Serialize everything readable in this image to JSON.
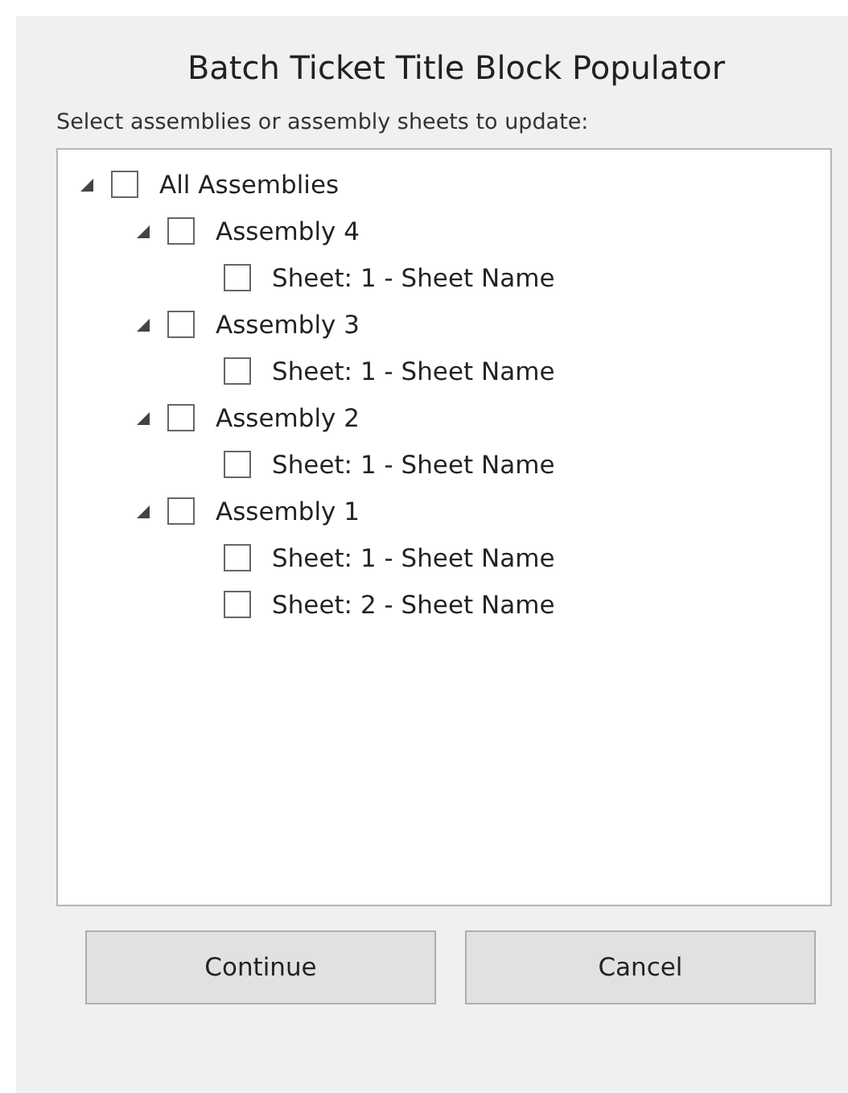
{
  "dialog": {
    "title": "Batch Ticket Title Block Populator",
    "instruction": "Select assemblies or assembly sheets to update:"
  },
  "tree": [
    {
      "label": "All Assemblies",
      "checked": false,
      "expanded": true,
      "children": [
        {
          "label": "Assembly 4",
          "checked": false,
          "expanded": true,
          "children": [
            {
              "label": "Sheet: 1 - Sheet Name",
              "checked": false
            }
          ]
        },
        {
          "label": "Assembly 3",
          "checked": false,
          "expanded": true,
          "children": [
            {
              "label": "Sheet: 1 - Sheet Name",
              "checked": false
            }
          ]
        },
        {
          "label": "Assembly 2",
          "checked": false,
          "expanded": true,
          "children": [
            {
              "label": "Sheet: 1 - Sheet Name",
              "checked": false
            }
          ]
        },
        {
          "label": "Assembly 1",
          "checked": false,
          "expanded": true,
          "children": [
            {
              "label": "Sheet: 1 - Sheet Name",
              "checked": false
            },
            {
              "label": "Sheet: 2 - Sheet Name",
              "checked": false
            }
          ]
        }
      ]
    }
  ],
  "buttons": [
    "Continue",
    "Cancel"
  ]
}
